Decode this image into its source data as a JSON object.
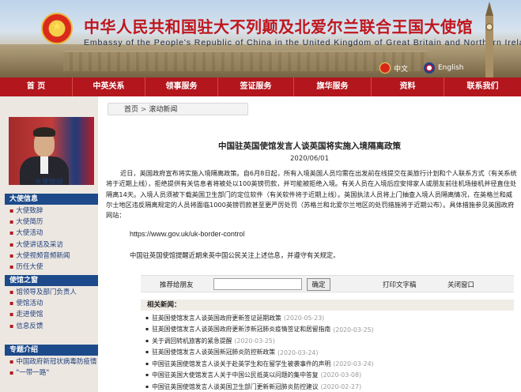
{
  "header": {
    "title_cn": "中华人民共和国驻大不列颠及北爱尔兰联合王国大使馆",
    "title_en": "Embassy of the People's Republic of China in the United Kingdom of Great Britain and Northern Ireland",
    "lang_cn": "中文",
    "lang_en": "English"
  },
  "nav": [
    "首 页",
    "中英关系",
    "领事服务",
    "签证服务",
    "旗华服务",
    "资料",
    "联系我们"
  ],
  "sidebar": {
    "photo_caption": "大使致辞",
    "section1": {
      "title": "大使信息",
      "items": [
        "大使致辞",
        "大使简历",
        "大使活动",
        "大使讲话及采访",
        "大使视频音频新闻",
        "历任大使"
      ]
    },
    "section2": {
      "title": "使馆之窗",
      "items": [
        "馆领导及部门负责人",
        "使馆活动",
        "走进使馆",
        "信息反馈"
      ]
    },
    "section3": {
      "title": "专题介绍",
      "items": [
        "中国政府新冠状病毒防疫情",
        "\"一带一路\""
      ]
    }
  },
  "content": {
    "breadcrumb": {
      "home": "首页",
      "sep": ">",
      "current": "滚动新闻"
    },
    "title": "中国驻英国使馆发言人谈英国将实施入境隔离政策",
    "date": "2020/06/01",
    "body": "近日，英国政府宣布将实施入境隔离政策。自6月8日起，所有入境英国人员均需在出发前在线提交在英旅行计划和个人联系方式（有关系统将于近期上线），拒绝提供有关信息者将被处以100英镑罚款，并可能被拒绝入境。有关人员在入境后应安排家人或朋友前往机场接机并径直住处隔离14天。入境人员须被下载英国卫生部门的定位软件（有关软件将于近期上线）。英国执法人员将上门抽查入境人员隔离情况，在英格兰和威尔士地区违反隔离规定的人员将面临1000英镑罚款甚至更严厉处罚（苏格兰和北爱尔兰地区的处罚措施将于近期公布）。具体措施参见英国政府网站：",
    "url": "https://www.gov.uk/uk-border-control",
    "note": "中国驻英国使馆提醒近期来英中国公民关注上述信息，并遵守有关规定。",
    "tools": {
      "recommend_label": "推荐给朋友",
      "input_value": "",
      "submit_label": "确定",
      "print_label": "打印文字稿",
      "close_label": "关闭窗口"
    },
    "related": {
      "title": "相关新闻：",
      "items": [
        {
          "text": "驻英国使馆发言人谈英国政府更新签证延期政策",
          "date": "(2020-05-23)"
        },
        {
          "text": "驻英国使馆发言人谈英国政府更新涉新冠肺炎疫情签证和居留指南",
          "date": "(2020-03-25)"
        },
        {
          "text": "关于调回转机旅客的紧急提醒",
          "date": "(2020-03-25)"
        },
        {
          "text": "驻英国使馆发言人谈英国新冠肺炎防控新政策",
          "date": "(2020-03-24)"
        },
        {
          "text": "中国驻英国使馆发言人谈关于赴英学生和在留学生被袭事件的声明",
          "date": "(2020-03-24)"
        },
        {
          "text": "中国驻英国大使馆发言人关于中国公民抵英以问题的集中答复",
          "date": "(2020-03-08)"
        },
        {
          "text": "中国驻英国使馆发言人谈英国卫生部门更新新冠肺炎防控建议",
          "date": "(2020-02-27)"
        }
      ]
    }
  },
  "colors": {
    "nav_bg": "#b3161d",
    "side_head_bg": "#1c4a8a",
    "sidebar_bg": "#ece7e1",
    "title_red": "#c0161c"
  }
}
